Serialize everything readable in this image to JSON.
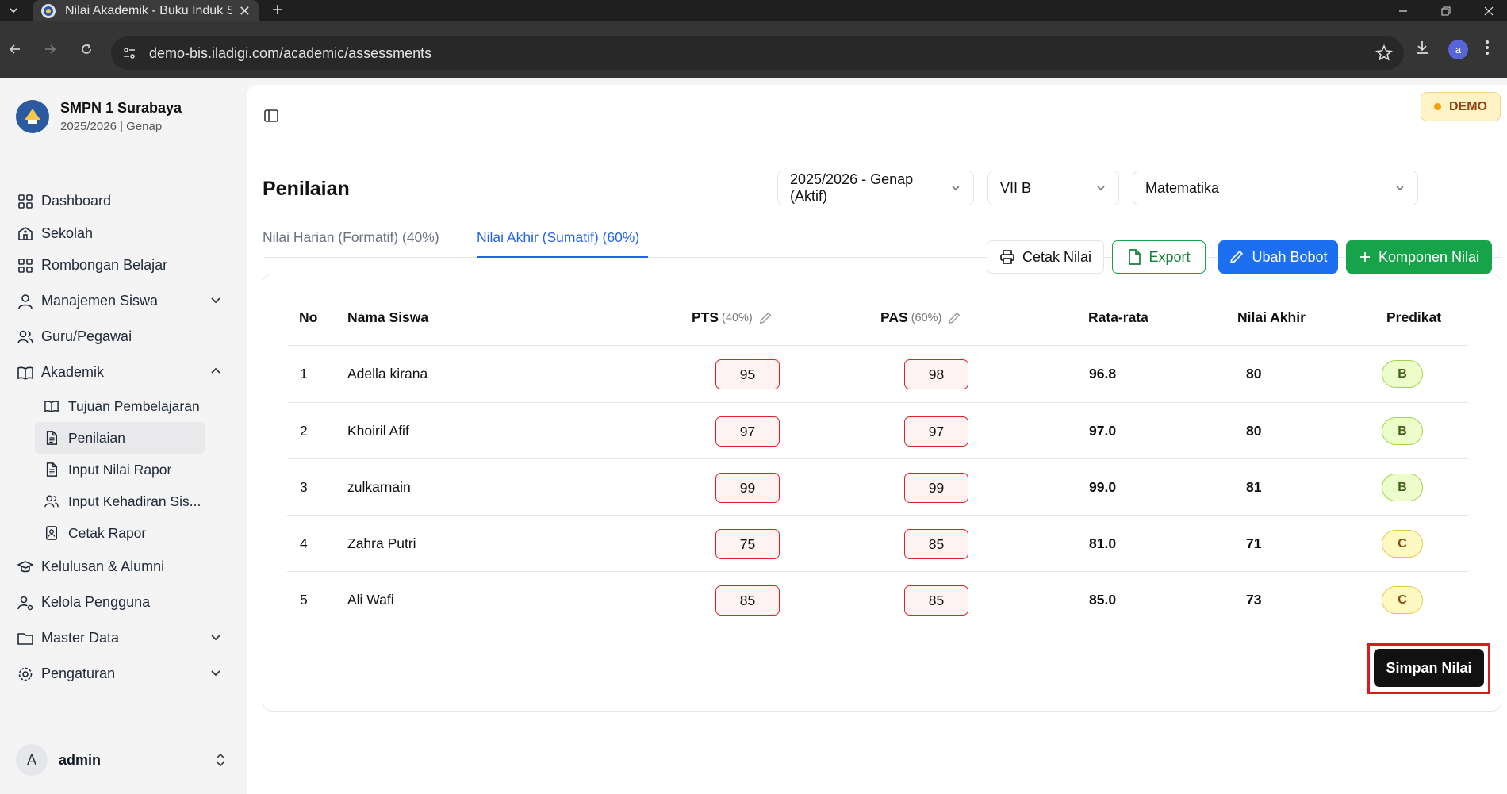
{
  "browser": {
    "tab_title": "Nilai Akademik - Buku Induk Si",
    "url": "demo-bis.iladigi.com/academic/assessments",
    "profile_initial": "a"
  },
  "school": {
    "name": "SMPN 1 Surabaya",
    "period": "2025/2026 | Genap"
  },
  "sidebar": {
    "items": [
      {
        "label": "Dashboard",
        "icon": "grid-icon"
      },
      {
        "label": "Sekolah",
        "icon": "school-icon"
      },
      {
        "label": "Rombongan Belajar",
        "icon": "grid-icon"
      },
      {
        "label": "Manajemen Siswa",
        "icon": "user-icon",
        "expandable": true
      },
      {
        "label": "Guru/Pegawai",
        "icon": "users-icon"
      },
      {
        "label": "Akademik",
        "icon": "book-open-icon",
        "expanded": true
      },
      {
        "label": "Kelulusan & Alumni",
        "icon": "graduation-cap-icon"
      },
      {
        "label": "Kelola Pengguna",
        "icon": "user-cog-icon"
      },
      {
        "label": "Master Data",
        "icon": "folder-icon",
        "expandable": true
      },
      {
        "label": "Pengaturan",
        "icon": "gear-icon",
        "expandable": true
      }
    ],
    "sub_items": [
      {
        "label": "Tujuan Pembelajaran",
        "icon": "book-open-icon"
      },
      {
        "label": "Penilaian",
        "icon": "file-text-icon",
        "active": true
      },
      {
        "label": "Input Nilai Rapor",
        "icon": "file-text-icon"
      },
      {
        "label": "Input Kehadiran Sis...",
        "icon": "users-icon"
      },
      {
        "label": "Cetak Rapor",
        "icon": "file-user-icon"
      }
    ],
    "user": {
      "initial": "A",
      "name": "admin"
    }
  },
  "header": {
    "demo_badge": "DEMO"
  },
  "page": {
    "title": "Penilaian",
    "filters": {
      "period": "2025/2026 - Genap (Aktif)",
      "class": "VII B",
      "subject": "Matematika"
    },
    "tabs": [
      {
        "label": "Nilai Harian (Formatif) (40%)",
        "active": false
      },
      {
        "label": "Nilai Akhir (Sumatif) (60%)",
        "active": true
      }
    ],
    "actions": {
      "print": "Cetak Nilai",
      "export": "Export",
      "change_weight": "Ubah Bobot",
      "add_component": "Komponen Nilai"
    }
  },
  "table": {
    "headers": {
      "no": "No",
      "name": "Nama Siswa",
      "pts": "PTS",
      "pts_weight": "(40%)",
      "pas": "PAS",
      "pas_weight": "(60%)",
      "average": "Rata-rata",
      "final": "Nilai Akhir",
      "grade": "Predikat"
    },
    "rows": [
      {
        "no": "1",
        "name": "Adella kirana",
        "pts": "95",
        "pas": "98",
        "avg": "96.8",
        "final": "80",
        "grade": "B"
      },
      {
        "no": "2",
        "name": "Khoiril Afif",
        "pts": "97",
        "pas": "97",
        "avg": "97.0",
        "final": "80",
        "grade": "B"
      },
      {
        "no": "3",
        "name": "zulkarnain",
        "pts": "99",
        "pas": "99",
        "avg": "99.0",
        "final": "81",
        "grade": "B"
      },
      {
        "no": "4",
        "name": "Zahra Putri",
        "pts": "75",
        "pas": "85",
        "avg": "81.0",
        "final": "71",
        "grade": "C"
      },
      {
        "no": "5",
        "name": "Ali Wafi",
        "pts": "85",
        "pas": "85",
        "avg": "85.0",
        "final": "73",
        "grade": "C"
      }
    ],
    "save_label": "Simpan Nilai"
  },
  "colors": {
    "accent_blue": "#2563eb",
    "green": "#16a34a",
    "score_border": "#dc2626",
    "highlight_frame": "#d91b1b"
  }
}
